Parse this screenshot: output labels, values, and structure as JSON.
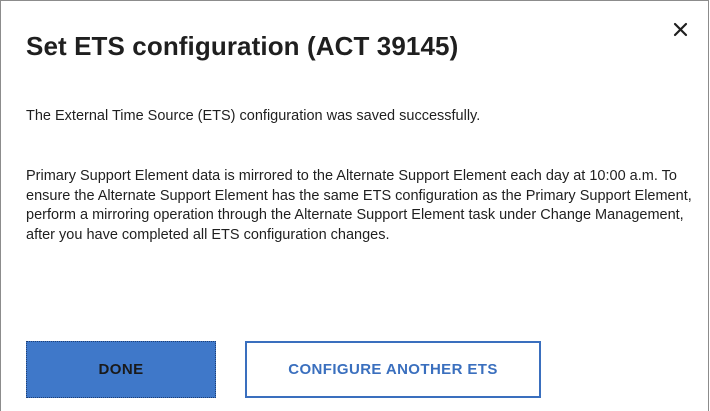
{
  "dialog": {
    "title": "Set ETS configuration (ACT 39145)",
    "close_icon": "close-icon",
    "success_message": "The External Time Source (ETS) configuration was saved successfully.",
    "info_paragraph": "Primary Support Element data is mirrored to the Alternate Support Element each day at 10:00 a.m. To ensure the Alternate Support Element has the same ETS configuration as the Primary Support Element, perform a mirroring operation through the Alternate Support Element task under Change Management, after you have completed all ETS configuration changes.",
    "buttons": {
      "done_label": "DONE",
      "configure_another_label": "CONFIGURE ANOTHER ETS"
    }
  },
  "colors": {
    "primary_button_bg": "#3f78c9",
    "secondary_button_border": "#3a6fbe",
    "text": "#1f1f1f"
  }
}
